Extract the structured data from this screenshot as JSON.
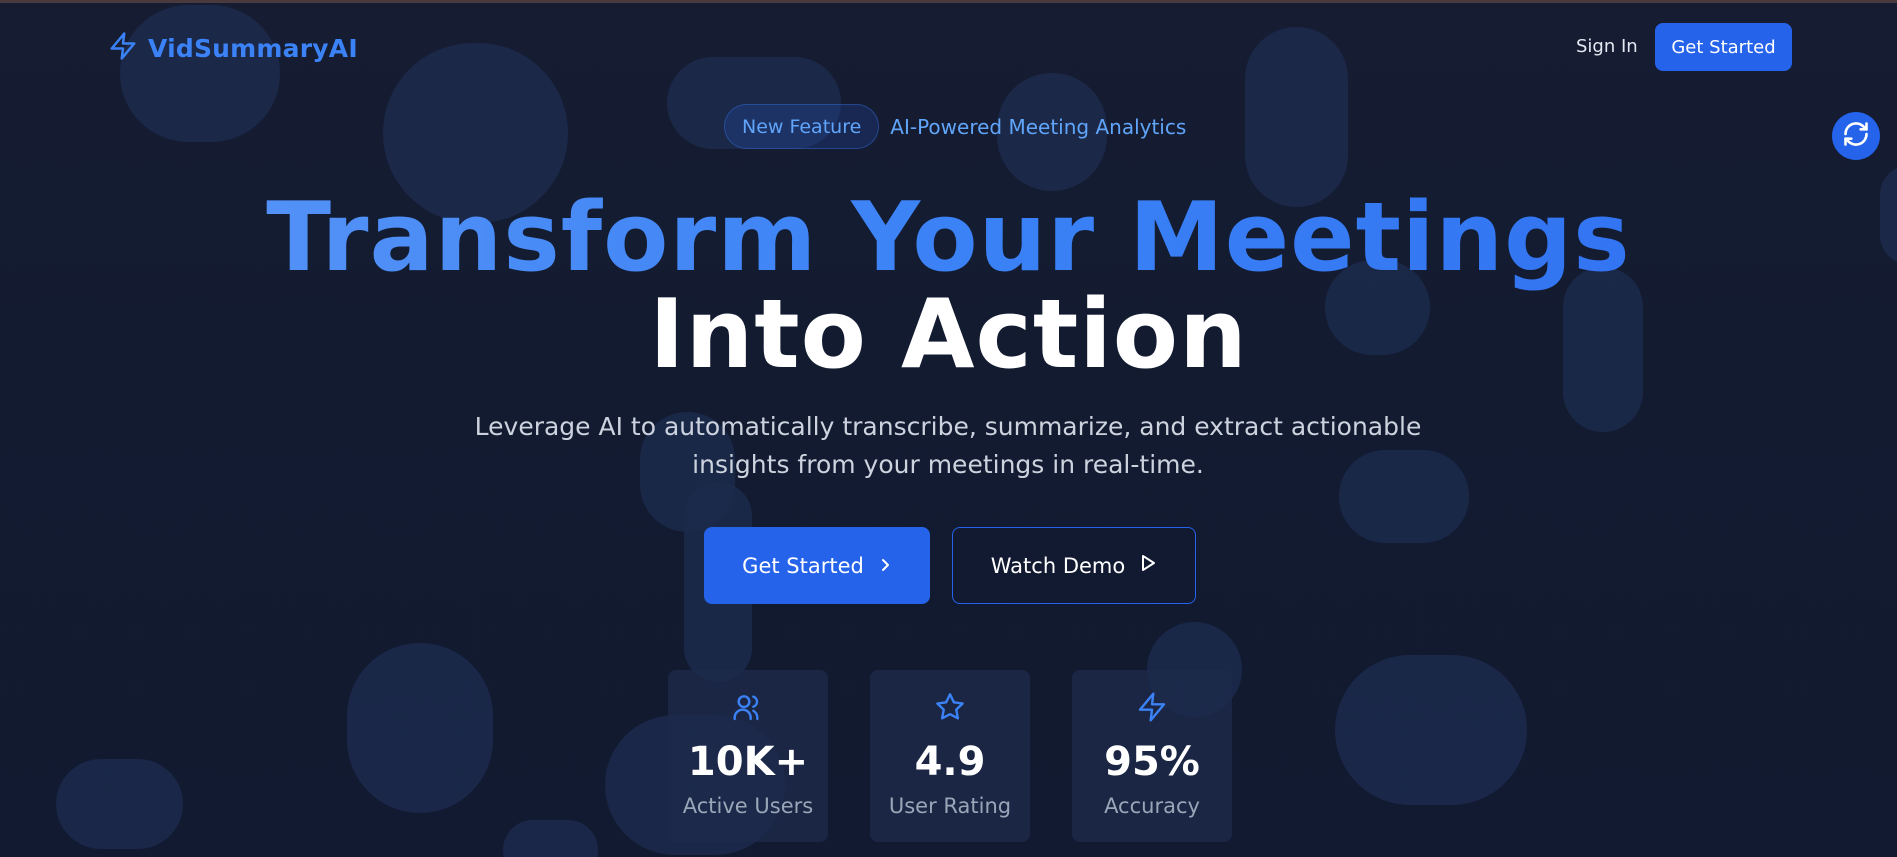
{
  "nav": {
    "logo_text": "VidSummaryAI",
    "signin_label": "Sign In",
    "cta_label": "Get Started"
  },
  "badge": {
    "pill_label": "New Feature",
    "text": "AI-Powered Meeting Analytics"
  },
  "hero": {
    "title_line1": "Transform Your Meetings",
    "title_line2": "Into Action",
    "subtitle_line1": "Leverage AI to automatically transcribe, summarize, and extract actionable",
    "subtitle_line2": "insights from your meetings in real-time."
  },
  "cta": {
    "primary_label": "Get Started",
    "secondary_label": "Watch Demo"
  },
  "stats": [
    {
      "icon": "users-icon",
      "value": "10K+",
      "label": "Active Users"
    },
    {
      "icon": "star-icon",
      "value": "4.9",
      "label": "User Rating"
    },
    {
      "icon": "zap-icon",
      "value": "95%",
      "label": "Accuracy"
    }
  ],
  "colors": {
    "accent": "#2563eb",
    "accent_light": "#3b82f6",
    "background": "#131b31"
  }
}
